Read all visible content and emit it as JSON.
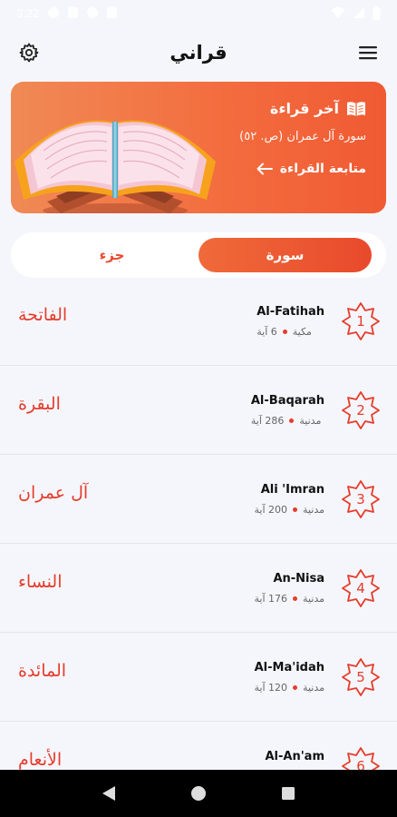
{
  "status_bar": {
    "time": "3:22"
  },
  "app": {
    "title": "قراني"
  },
  "last_read": {
    "heading": "آخر قراءة",
    "surah": "سورة آل عمران (ص. ٥٢)",
    "continue_label": "متابعة القراءة"
  },
  "tabs": {
    "surah": "سورة",
    "juz": "جزء"
  },
  "surahs": [
    {
      "number": "1",
      "name": "Al-Fatihah",
      "type": "مكية",
      "verses": "6 آية",
      "arabic": "الفاتحة"
    },
    {
      "number": "2",
      "name": "Al-Baqarah",
      "type": "مدنية",
      "verses": "286 آية",
      "arabic": "البقرة"
    },
    {
      "number": "3",
      "name": "Ali 'Imran",
      "type": "مدنية",
      "verses": "200 آية",
      "arabic": "آل عمران"
    },
    {
      "number": "4",
      "name": "An-Nisa",
      "type": "مدنية",
      "verses": "176 آية",
      "arabic": "النساء"
    },
    {
      "number": "5",
      "name": "Al-Ma'idah",
      "type": "مدنية",
      "verses": "120 آية",
      "arabic": "المائدة"
    },
    {
      "number": "6",
      "name": "Al-An'am",
      "type": "",
      "verses": "",
      "arabic": "الأنعام"
    }
  ],
  "colors": {
    "accent": "#e94a2e",
    "card_start": "#f08a55",
    "card_end": "#f05a33"
  }
}
